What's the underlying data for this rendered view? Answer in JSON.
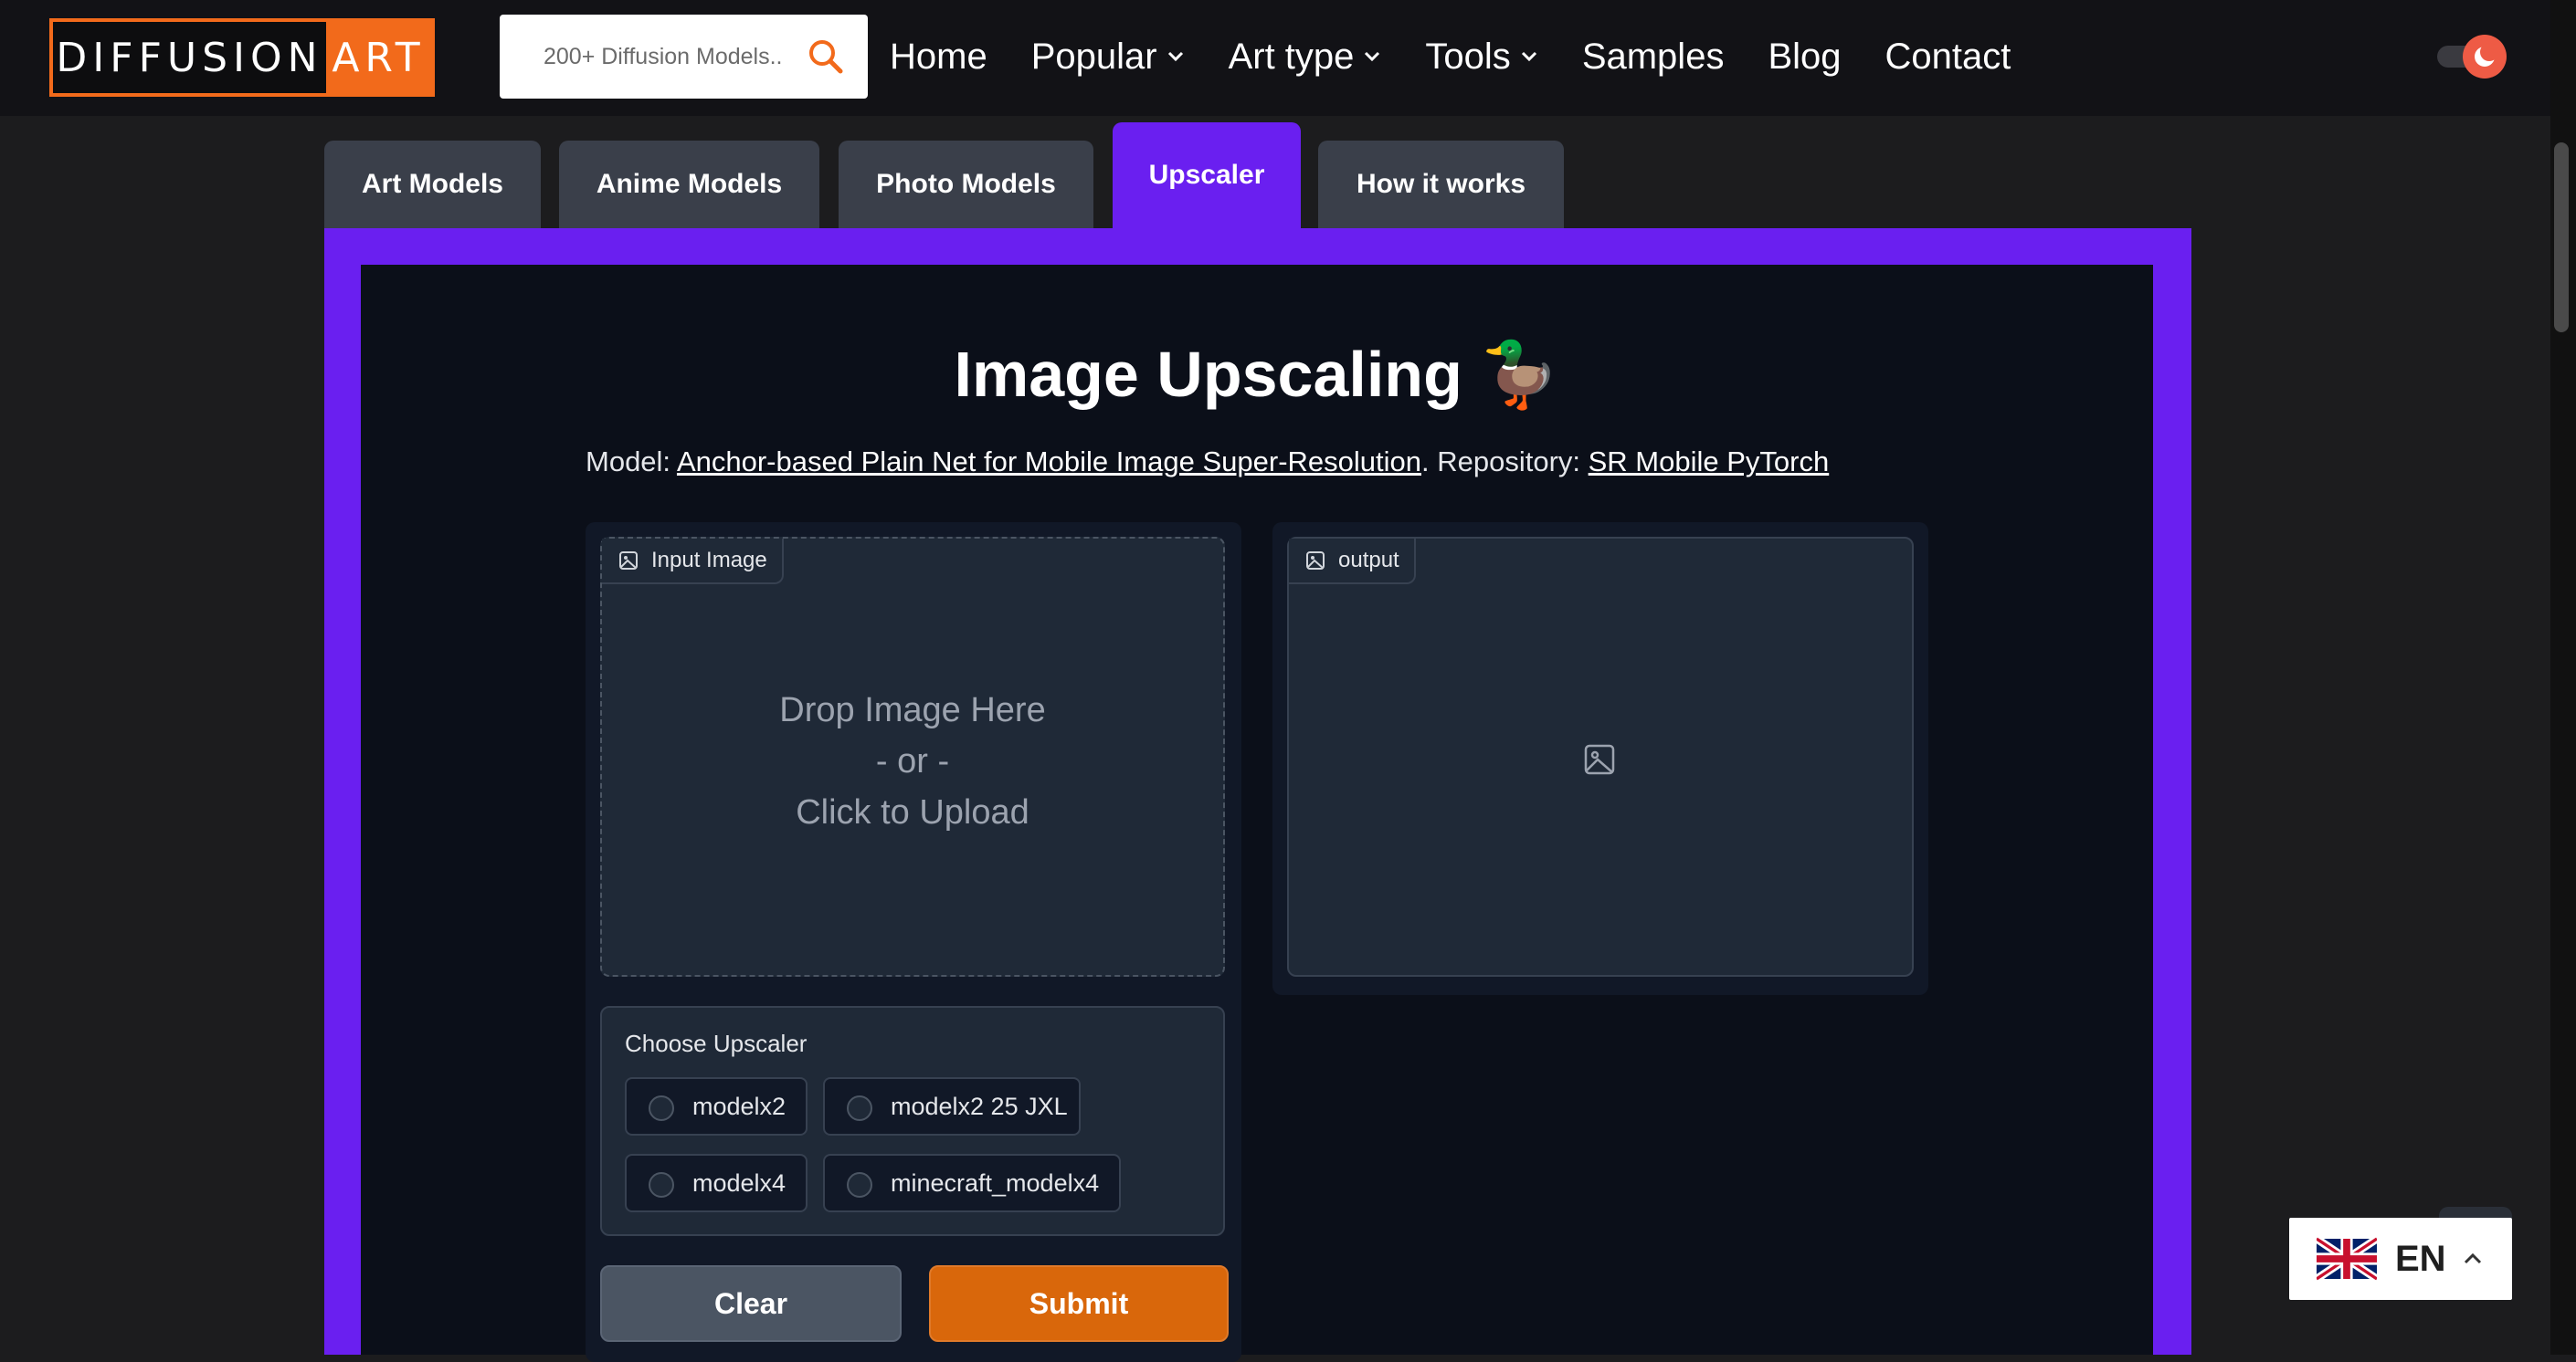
{
  "header": {
    "logo": {
      "left": "DIFFUSION",
      "right": "ART"
    },
    "search": {
      "placeholder": "200+ Diffusion Models.."
    },
    "nav": [
      {
        "label": "Home",
        "dropdown": false
      },
      {
        "label": "Popular",
        "dropdown": true
      },
      {
        "label": "Art type",
        "dropdown": true
      },
      {
        "label": "Tools",
        "dropdown": true
      },
      {
        "label": "Samples",
        "dropdown": false
      },
      {
        "label": "Blog",
        "dropdown": false
      },
      {
        "label": "Contact",
        "dropdown": false
      }
    ]
  },
  "tabs": [
    {
      "label": "Art Models",
      "active": false
    },
    {
      "label": "Anime Models",
      "active": false
    },
    {
      "label": "Photo Models",
      "active": false
    },
    {
      "label": "Upscaler",
      "active": true
    },
    {
      "label": "How it works",
      "active": false
    }
  ],
  "main": {
    "title": "Image Upscaling 🦆",
    "model_prefix": "Model: ",
    "model_link": "Anchor-based Plain Net for Mobile Image Super-Resolution",
    "repo_prefix": ". Repository: ",
    "repo_link": "SR Mobile PyTorch",
    "input": {
      "label": "Input Image",
      "drop_line1": "Drop Image Here",
      "drop_line2": "- or -",
      "drop_line3": "Click to Upload"
    },
    "output": {
      "label": "output"
    },
    "upscaler": {
      "title": "Choose Upscaler",
      "options": [
        "modelx2",
        "modelx2 25 JXL",
        "modelx4",
        "minecraft_modelx4"
      ]
    },
    "buttons": {
      "clear": "Clear",
      "submit": "Submit"
    }
  },
  "language": {
    "code": "EN"
  },
  "colors": {
    "accent": "#6a1ff0",
    "brand_orange": "#f26a1b",
    "submit": "#d9670b"
  }
}
